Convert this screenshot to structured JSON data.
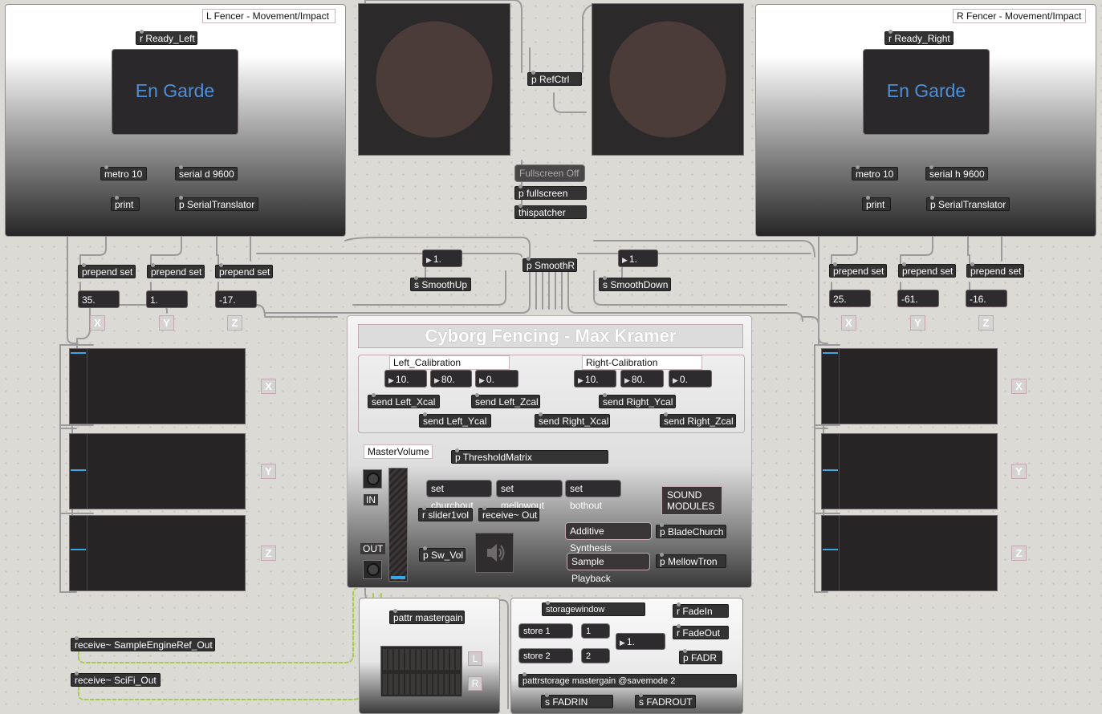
{
  "left_fencer": {
    "panel_title": "L Fencer - Movement/Impact",
    "receive": "r Ready_Left",
    "button_label": "En Garde",
    "metro": "metro 10",
    "serial": "serial d 9600",
    "print": "print",
    "translator": "p SerialTranslator",
    "prepend": [
      "prepend set",
      "prepend set",
      "prepend set"
    ],
    "values": [
      "35.",
      "1.",
      "-17."
    ],
    "axes": [
      "X",
      "Y",
      "Z"
    ],
    "slider_levels": [
      0.04,
      0.49,
      0.46
    ]
  },
  "right_fencer": {
    "panel_title": "R Fencer - Movement/Impact",
    "receive": "r Ready_Right",
    "button_label": "En Garde",
    "metro": "metro 10",
    "serial": "serial h 9600",
    "print": "print",
    "translator": "p SerialTranslator",
    "prepend": [
      "prepend set",
      "prepend set",
      "prepend set"
    ],
    "values": [
      "25.",
      "-61.",
      "-16."
    ],
    "axes": [
      "X",
      "Y",
      "Z"
    ],
    "slider_levels": [
      0.04,
      0.49,
      0.46
    ]
  },
  "referee": {
    "ctrl": "p RefCtrl",
    "fullscreen_msg": "Fullscreen Off",
    "fullscreen": "p fullscreen",
    "thispatcher": "thispatcher",
    "smooth": "p SmoothR",
    "smooth_up_value": "1.",
    "smooth_up": "s SmoothUp",
    "smooth_down_value": "1.",
    "smooth_down": "s SmoothDown"
  },
  "main": {
    "title": "Cyborg Fencing - Max Kramer",
    "left_cal_title": "Left_Calibration",
    "right_cal_title": "Right-Calibration",
    "left_cal_values": [
      "10.",
      "80.",
      "0."
    ],
    "right_cal_values": [
      "10.",
      "80.",
      "0."
    ],
    "send_left_x": "send Left_Xcal",
    "send_left_y": "send Left_Ycal",
    "send_left_z": "send Left_Zcal",
    "send_right_x": "send Right_Xcal",
    "send_right_y": "send Right_Ycal",
    "send_right_z": "send Right_Zcal",
    "master_volume": "MasterVolume",
    "threshold": "p ThresholdMatrix",
    "in_label": "IN",
    "out_label": "OUT",
    "set_church": "set churchout",
    "set_mellow": "set mellowout",
    "set_both": "set bothout",
    "slider_receive": "r slider1vol",
    "receive_out": "receive~ Out",
    "sw_vol": "p Sw_Vol",
    "additive": "Additive Synthesis",
    "sample_playback": "Sample Playback",
    "sound_modules": "SOUND MODULES",
    "blade_church": "p BladeChurch",
    "mellow_tron": "p MellowTron",
    "master_gain_level": 0.0
  },
  "bottom": {
    "receive_sample": "receive~ SampleEngineRef_Out",
    "receive_scifi": "receive~ SciFi_Out",
    "pattr": "pattr mastergain",
    "lr": [
      "L",
      "R"
    ],
    "storagewindow": "storagewindow",
    "store1": "store 1",
    "store2": "store 2",
    "num1": "1",
    "num2": "2",
    "fade_value": "1.",
    "fade_in": "r FadeIn",
    "fade_out": "r FadeOut",
    "fadr": "p FADR",
    "pattrstorage": "pattrstorage mastergain @savemode 2",
    "s_fadrin": "s FADRIN",
    "s_fadrout": "s FADROUT"
  },
  "colors": {
    "accent_blue": "#4d8fd8",
    "meter_tick": "#3aa7e3",
    "dial_circle": "#4b3c39",
    "patch_cord": "#a8a8a8",
    "signal_cord": "#9fc14b"
  }
}
